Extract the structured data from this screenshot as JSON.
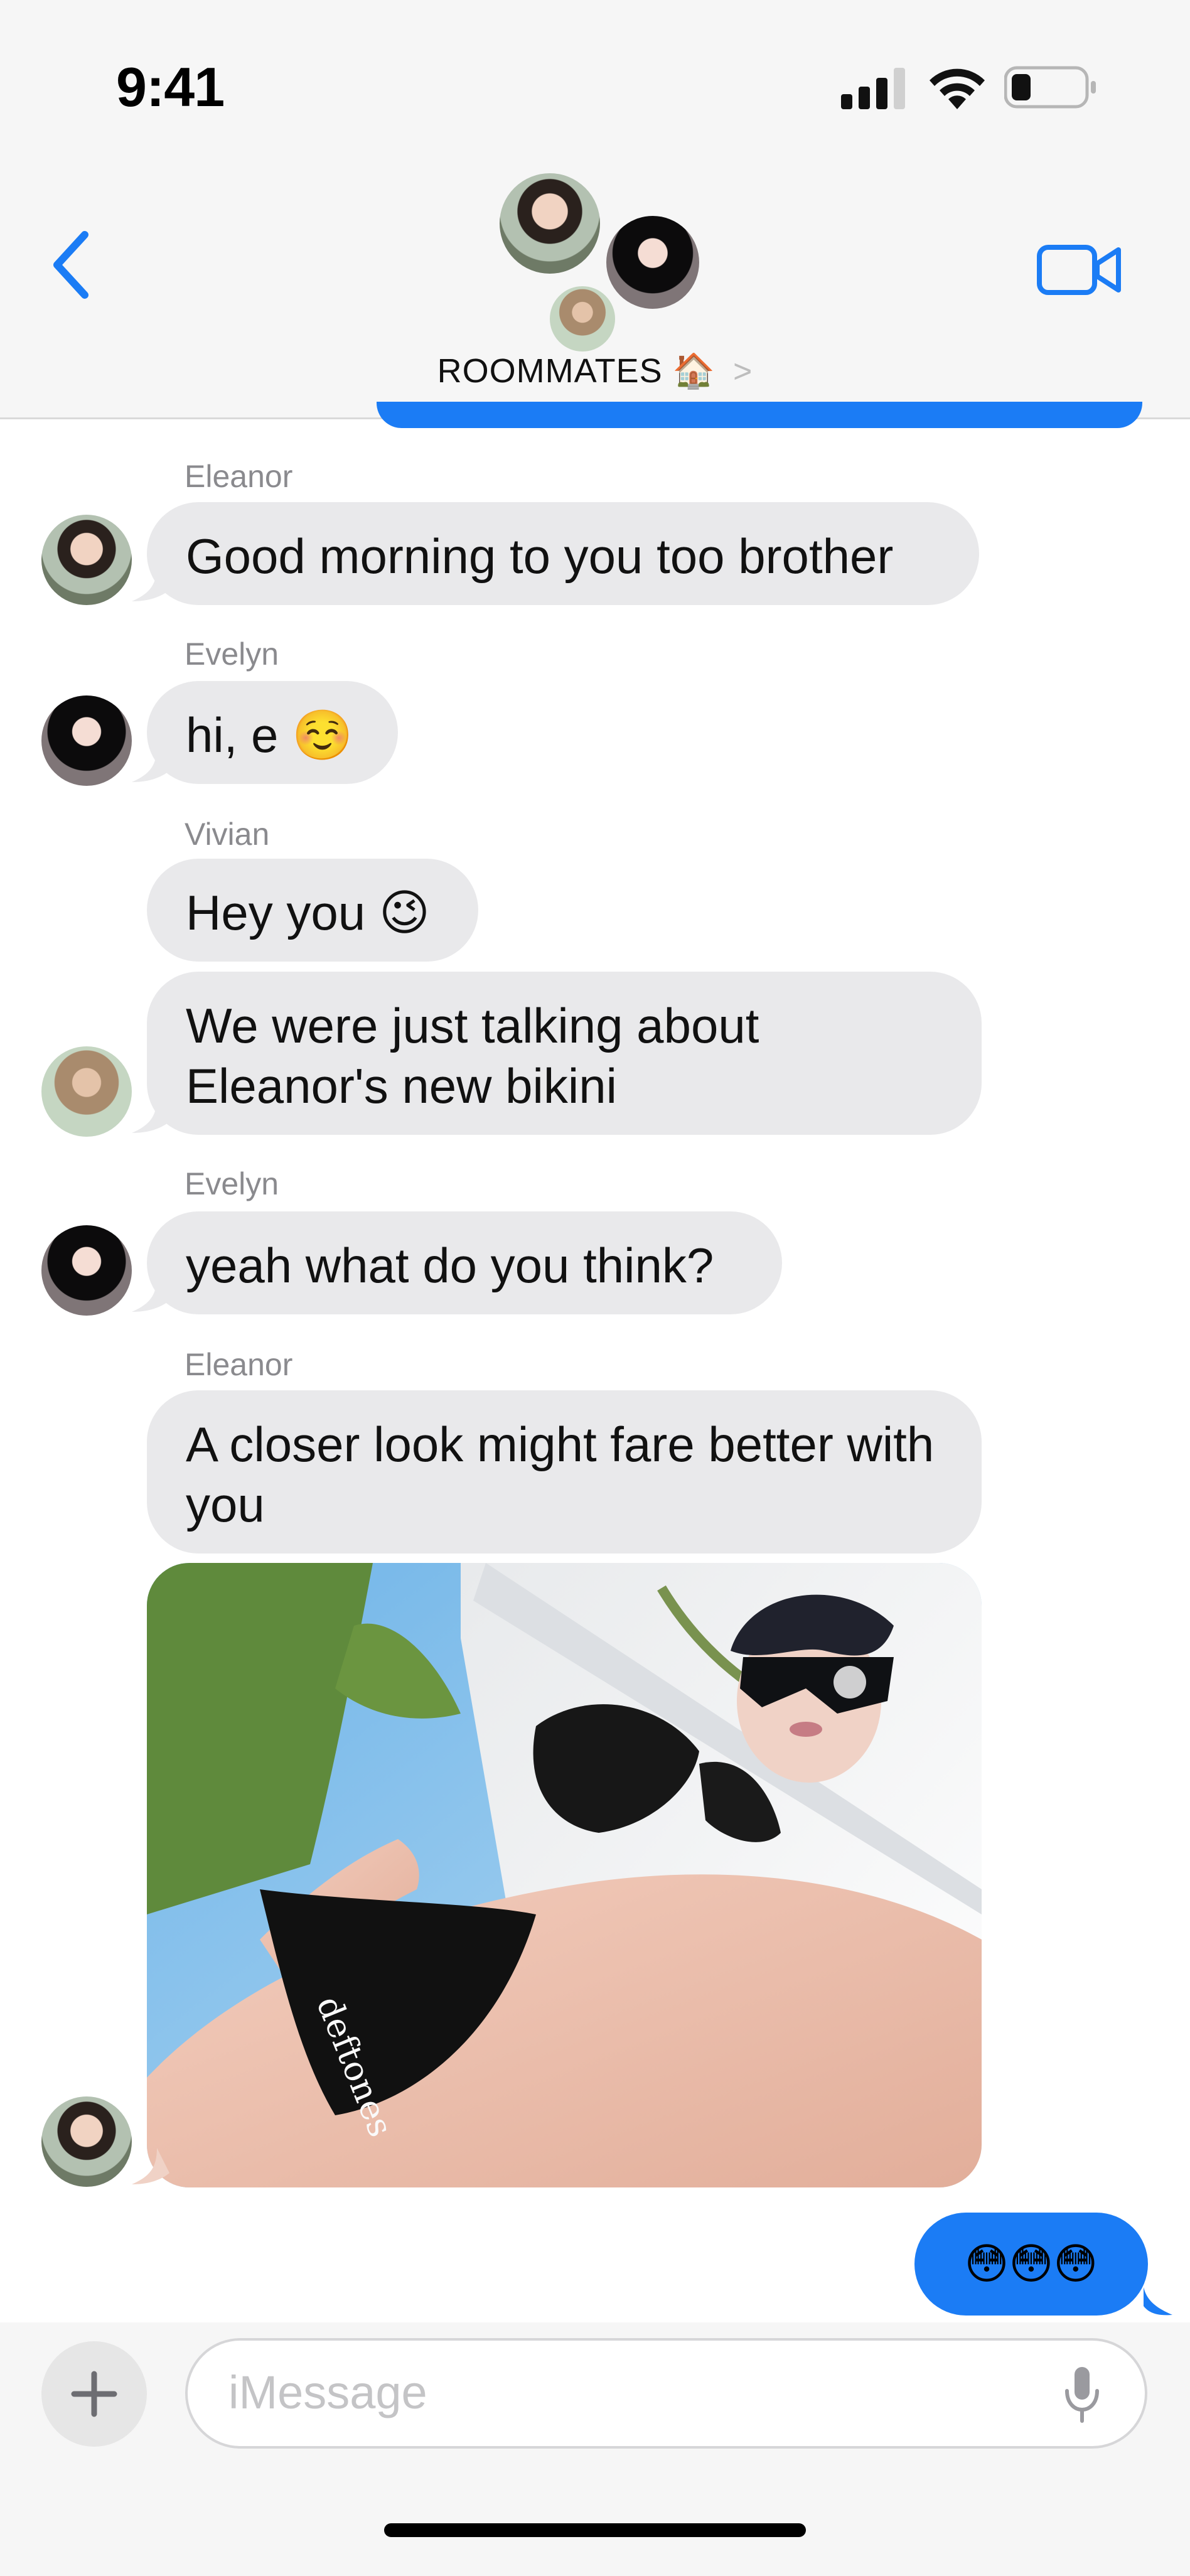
{
  "status_bar": {
    "time": "9:41",
    "icons": [
      "cellular-signal-icon",
      "wifi-icon",
      "battery-icon"
    ]
  },
  "header": {
    "title": "ROOMMATES",
    "title_emoji": "🏠",
    "chevron": ">",
    "back_icon": "chevron-left-icon",
    "video_icon": "video-camera-icon",
    "accent_color": "#1b7cf5"
  },
  "messages": [
    {
      "sender": "Eleanor",
      "text": "Good morning to you too brother"
    },
    {
      "sender": "Evelyn",
      "text": "hi, e ☺️"
    },
    {
      "sender": "Vivian",
      "text": "Hey you 😉"
    },
    {
      "sender": "",
      "text": "We were just talking about Eleanor's new bikini"
    },
    {
      "sender": "Evelyn",
      "text": "yeah what do you think?"
    },
    {
      "sender": "Eleanor",
      "text": "A closer look might fare better with you"
    }
  ],
  "photo": {
    "printed_text": "deftones"
  },
  "sent_message": {
    "text": "😳😳😳"
  },
  "composer": {
    "placeholder": "iMessage",
    "plus_label": "+"
  }
}
